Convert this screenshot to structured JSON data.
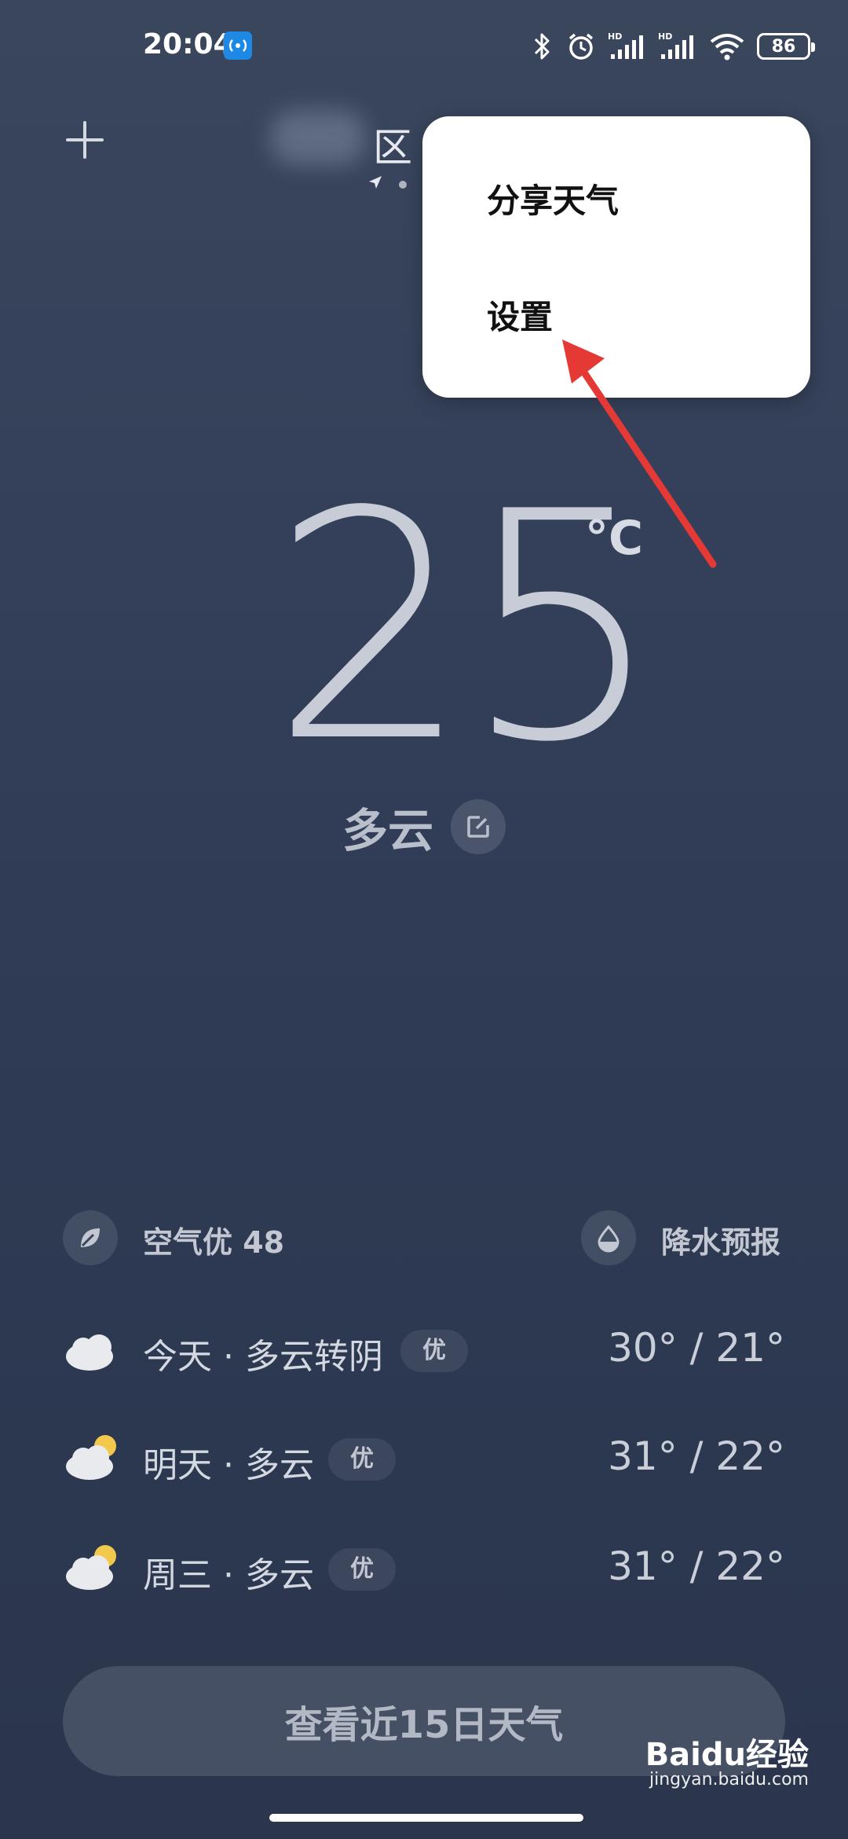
{
  "status_bar": {
    "time": "20:04",
    "battery": "86"
  },
  "header": {
    "location_suffix": "区"
  },
  "menu": {
    "share_label": "分享天气",
    "settings_label": "设置"
  },
  "current": {
    "temperature": "25",
    "unit": "°C",
    "condition": "多云"
  },
  "info": {
    "aqi_label": "空气优 48",
    "rain_label": "降水预报"
  },
  "forecast": [
    {
      "day": "今天 · 多云转阴",
      "aqi": "优",
      "temp": "30° / 21°"
    },
    {
      "day": "明天 · 多云",
      "aqi": "优",
      "temp": "31° / 22°"
    },
    {
      "day": "周三 · 多云",
      "aqi": "优",
      "temp": "31° / 22°"
    }
  ],
  "actions": {
    "days15_label": "查看近15日天气"
  },
  "watermark": {
    "logo": "Baidu经验",
    "sub": "jingyan.baidu.com"
  },
  "colors": {
    "menu_bg": "#ffffff",
    "accent_arrow": "#e53935",
    "hotspot_badge": "#1e88e5"
  }
}
